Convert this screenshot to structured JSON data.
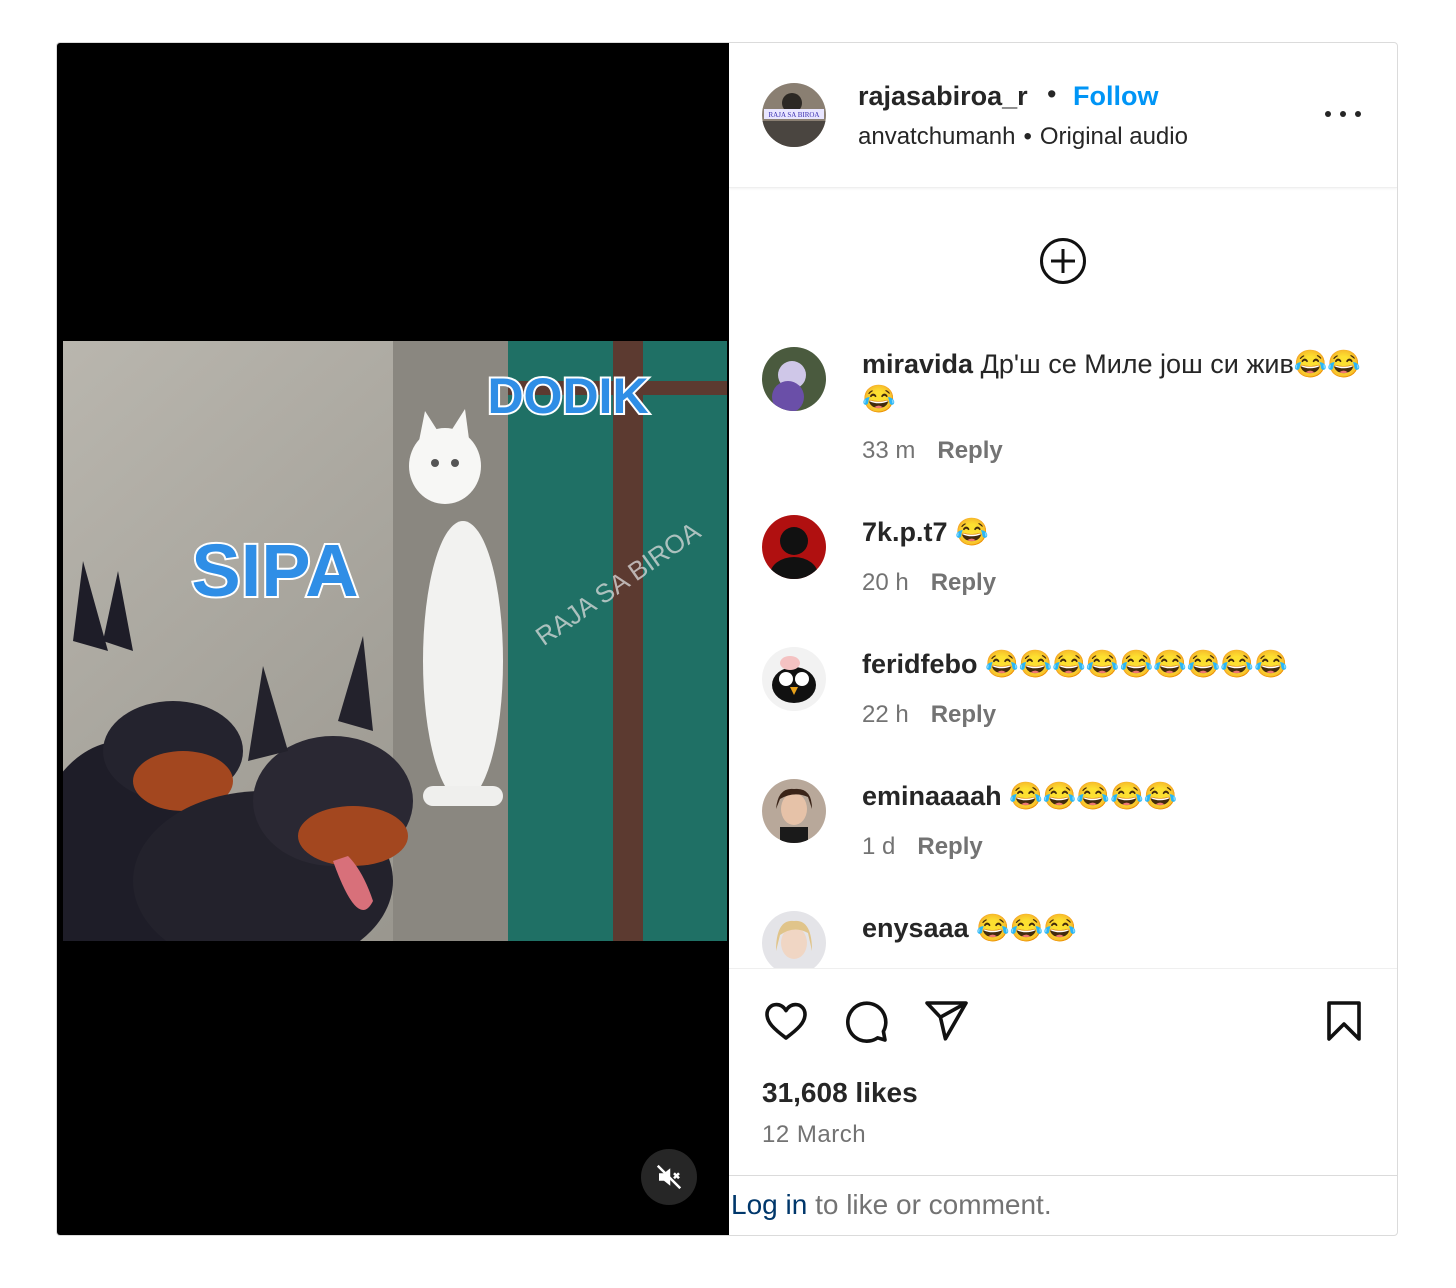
{
  "post": {
    "username": "rajasabiroa_r",
    "follow_label": "Follow",
    "separator": "•",
    "audio_author": "anvatchumanh",
    "audio_title": "Original audio",
    "avatar_text": "RAJA SA BIROA"
  },
  "video": {
    "label_left": "SIPA",
    "label_right": "DODIK",
    "watermark": "RAJA SA BIROA",
    "muted": true
  },
  "comments": [
    {
      "user": "miravida",
      "text": "Др'ш се Миле још си жив😂😂😂",
      "time": "33 m",
      "reply": "Reply"
    },
    {
      "user": "7k.p.t7",
      "text": "😂",
      "time": "20 h",
      "reply": "Reply"
    },
    {
      "user": "feridfebo",
      "text": "😂😂😂😂😂😂😂😂😂",
      "time": "22 h",
      "reply": "Reply"
    },
    {
      "user": "eminaaaah",
      "text": "😂😂😂😂😂",
      "time": "1 d",
      "reply": "Reply"
    },
    {
      "user": "enysaaa",
      "text": "😂😂😂",
      "time": "",
      "reply": ""
    }
  ],
  "stats": {
    "likes": "31,608 likes",
    "date": "12 March"
  },
  "footer": {
    "login_link": "Log in",
    "rest": " to like or comment."
  },
  "icons": [
    "more-icon",
    "add-comment-icon",
    "heart-icon",
    "comment-icon",
    "share-icon",
    "bookmark-icon",
    "mute-icon"
  ],
  "colors": {
    "accent": "#0095f6",
    "text": "#262626",
    "muted_text": "#737373",
    "link": "#00376b"
  }
}
